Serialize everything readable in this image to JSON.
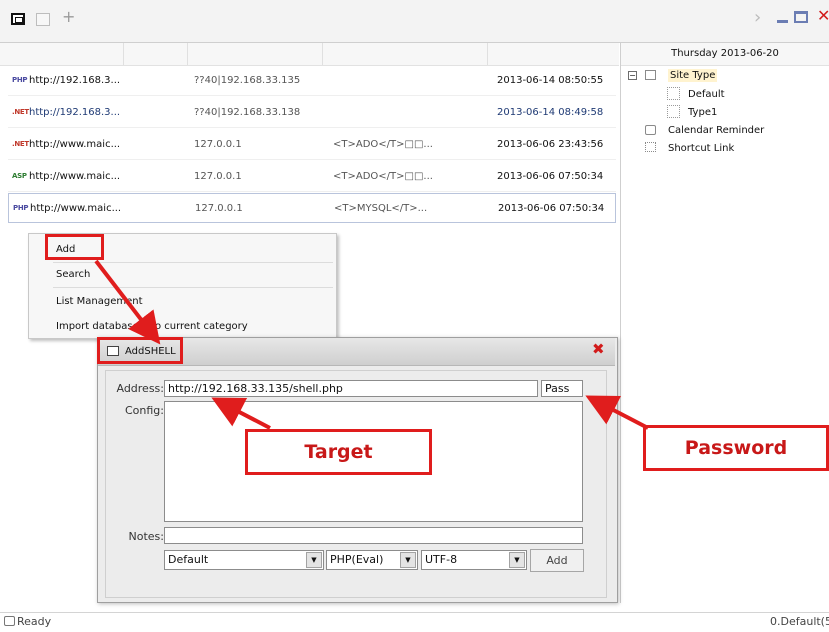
{
  "rows": [
    {
      "type": "PHP",
      "type_color": "#4a4aa0",
      "url": "http://192.168.3...",
      "ip": "??40|192.168.33.135",
      "info": "",
      "date": "2013-06-14 08:50:55"
    },
    {
      "type": ".NET",
      "type_color": "#c0392b",
      "url": "http://192.168.3...",
      "ip": "??40|192.168.33.138",
      "info": "",
      "date": "2013-06-14 08:49:58"
    },
    {
      "type": ".NET",
      "type_color": "#c0392b",
      "url": "http://www.maic...",
      "ip": "127.0.0.1",
      "info": "<T>ADO</T>□□...",
      "date": "2013-06-06 23:43:56"
    },
    {
      "type": "ASP",
      "type_color": "#2e7d32",
      "url": "http://www.maic...",
      "ip": "127.0.0.1",
      "info": "<T>ADO</T>□□...",
      "date": "2013-06-06 07:50:34"
    },
    {
      "type": "PHP",
      "type_color": "#4a4aa0",
      "url": "http://www.maic...",
      "ip": "127.0.0.1",
      "info": "<T>MYSQL</T>...",
      "date": "2013-06-06 07:50:34"
    }
  ],
  "right_panel": {
    "date": "Thursday 2013-06-20",
    "tree": {
      "root": "Site Type",
      "children": [
        "Default",
        "Type1"
      ],
      "items": [
        "Calendar Reminder",
        "Shortcut Link"
      ]
    }
  },
  "context_menu": {
    "items": [
      "Add",
      "Search",
      "List Management",
      "Import database into current category"
    ]
  },
  "dialog": {
    "title": "AddSHELL",
    "address_label": "Address:",
    "address_value": "http://192.168.33.135/shell.php",
    "password_value": "Pass",
    "config_label": "Config:",
    "config_value": "",
    "notes_label": "Notes:",
    "notes_value": "",
    "category_selected": "Default",
    "script_type_selected": "PHP(Eval)",
    "encoding_selected": "UTF-8",
    "add_button": "Add"
  },
  "callouts": {
    "target": "Target",
    "password": "Password"
  },
  "status": {
    "left": "Ready",
    "right": "0.Default(5"
  },
  "colors": {
    "callout_red": "#e01d1d",
    "close_red": "#d21b1b"
  }
}
